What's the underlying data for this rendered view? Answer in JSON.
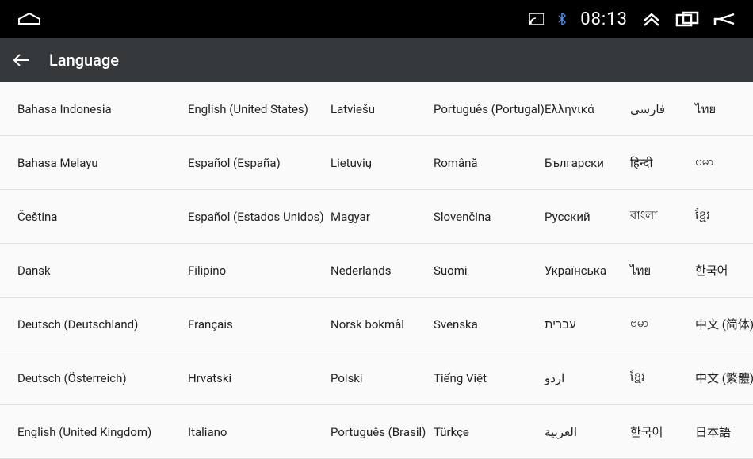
{
  "status": {
    "time": "08:13"
  },
  "header": {
    "title": "Language"
  },
  "languages": {
    "col0": [
      "Bahasa Indonesia",
      "Bahasa Melayu",
      "Čeština",
      "Dansk",
      "Deutsch (Deutschland)",
      "Deutsch (Österreich)",
      "English (United Kingdom)"
    ],
    "col1": [
      "English (United States)",
      "Español (España)",
      "Español (Estados Unidos)",
      "Filipino",
      "Français",
      "Hrvatski",
      "Italiano"
    ],
    "col2": [
      "Latviešu",
      "Lietuvių",
      "Magyar",
      "Nederlands",
      "Norsk bokmål",
      "Polski",
      "Português (Brasil)"
    ],
    "col3": [
      "Português (Portugal)",
      "Română",
      "Slovenčina",
      "Suomi",
      "Svenska",
      "Tiếng Việt",
      "Türkçe"
    ],
    "col4": [
      "Ελληνικά",
      "Български",
      "Русский",
      "Українська",
      "עברית",
      "اردو",
      "العربية"
    ],
    "col5": [
      "فارسى",
      "हिन्दी",
      "বাংলা",
      "ไทย",
      "ဗမာ",
      "ខ្មែរ",
      "한국어"
    ],
    "col6": [
      "ไทย",
      "ဗမာ",
      "ខ្មែរ",
      "한국어",
      "中文 (简体)",
      "中文 (繁體)",
      "日本語"
    ]
  }
}
